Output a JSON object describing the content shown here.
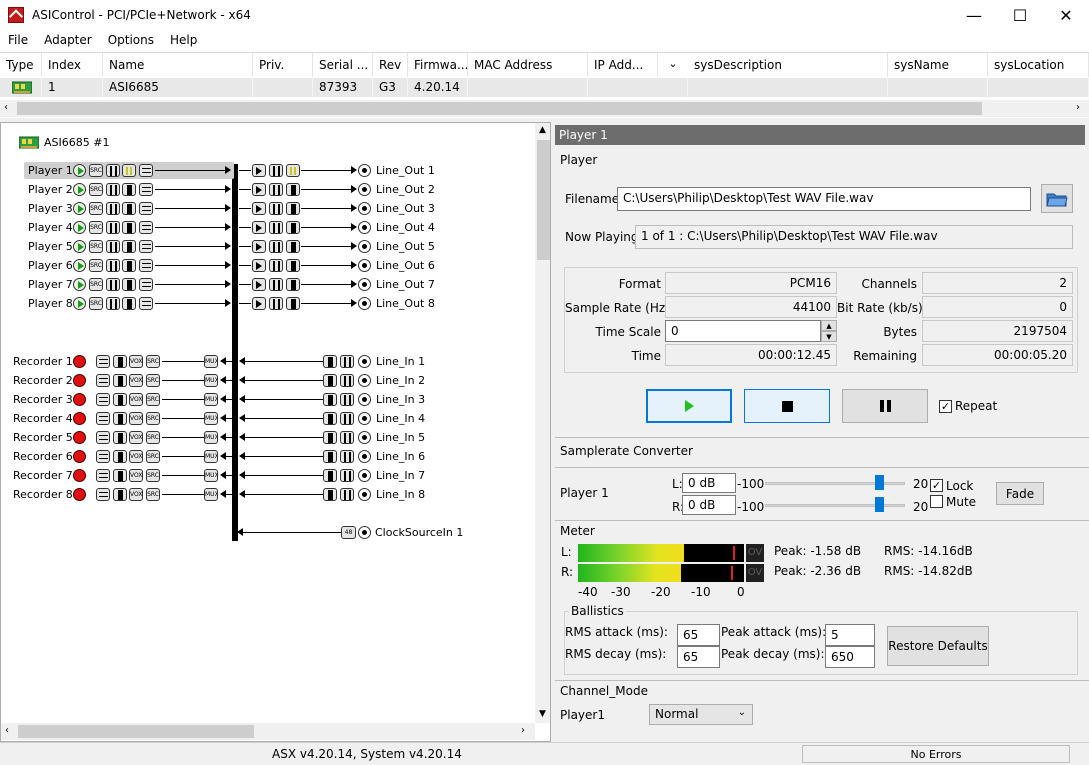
{
  "window": {
    "title": "ASIControl - PCI/PCIe+Network - x64",
    "minimize": "—",
    "maximize": "☐",
    "close": "✕"
  },
  "menu": [
    "File",
    "Adapter",
    "Options",
    "Help"
  ],
  "adapter_table": {
    "columns": [
      "Type",
      "Index",
      "Name",
      "Priv.",
      "Serial ...",
      "Rev",
      "Firmwa...",
      "MAC Address",
      "IP Add...",
      "sysDescription",
      "sysName",
      "sysLocation"
    ],
    "row": {
      "index": "1",
      "name": "ASI6685",
      "priv": "",
      "serial": "87393",
      "rev": "G3",
      "firmware": "4.20.14",
      "mac": "",
      "ip": "",
      "sysdesc": "",
      "sysname": "",
      "syslocation": ""
    }
  },
  "tree": {
    "adapter_label": "ASI6685 #1",
    "players": [
      "Player  1",
      "Player  2",
      "Player  3",
      "Player  4",
      "Player  5",
      "Player  6",
      "Player  7",
      "Player  8"
    ],
    "line_outs": [
      "Line_Out  1",
      "Line_Out  2",
      "Line_Out  3",
      "Line_Out  4",
      "Line_Out  5",
      "Line_Out  6",
      "Line_Out  7",
      "Line_Out  8"
    ],
    "recorders": [
      "Recorder  1",
      "Recorder  2",
      "Recorder  3",
      "Recorder  4",
      "Recorder  5",
      "Recorder  6",
      "Recorder  7",
      "Recorder  8"
    ],
    "line_ins": [
      "Line_In  1",
      "Line_In  2",
      "Line_In  3",
      "Line_In  4",
      "Line_In  5",
      "Line_In  6",
      "Line_In  7",
      "Line_In  8"
    ],
    "clock": "ClockSourceIn  1",
    "chip_src": "SRC",
    "chip_mux": "MUX",
    "chip_vox": "VOX",
    "chip_clock": "48"
  },
  "player_panel": {
    "header": "Player  1",
    "group_title": "Player",
    "filename_label": "Filename",
    "filename_value": "C:\\Users\\Philip\\Desktop\\Test WAV File.wav",
    "now_playing_label": "Now Playing",
    "now_playing_value": "1 of 1 : C:\\Users\\Philip\\Desktop\\Test WAV File.wav",
    "format_label": "Format",
    "format_value": "PCM16",
    "channels_label": "Channels",
    "channels_value": "2",
    "samplerate_label": "Sample Rate (Hz)",
    "samplerate_value": "44100",
    "bitrate_label": "Bit Rate (kb/s)",
    "bitrate_value": "0",
    "timescale_label": "Time Scale",
    "timescale_value": "0",
    "bytes_label": "Bytes",
    "bytes_value": "2197504",
    "time_label": "Time",
    "time_value": "00:00:12.45",
    "remaining_label": "Remaining",
    "remaining_value": "00:00:05.20",
    "repeat_label": "Repeat"
  },
  "src_panel": {
    "title": "Samplerate Converter",
    "player_label": "Player  1",
    "l_label": "L:",
    "r_label": "R:",
    "l_value": "0 dB",
    "r_value": "0 dB",
    "min_label": "-100",
    "max_label": "20",
    "lock_label": "Lock",
    "mute_label": "Mute",
    "fade_label": "Fade"
  },
  "meter": {
    "title": "Meter",
    "l_label": "L:",
    "r_label": "R:",
    "ov_label": "OV",
    "l_peak": "Peak: -1.58 dB",
    "l_rms": "RMS: -14.16dB",
    "r_peak": "Peak: -2.36 dB",
    "r_rms": "RMS: -14.82dB",
    "scale": [
      "-40",
      "-30",
      "-20",
      "-10",
      "0"
    ]
  },
  "ballistics": {
    "title": "Ballistics",
    "rms_attack_label": "RMS attack (ms):",
    "rms_attack_value": "65",
    "rms_decay_label": "RMS decay (ms):",
    "rms_decay_value": "65",
    "peak_attack_label": "Peak attack (ms):",
    "peak_attack_value": "5",
    "peak_decay_label": "Peak decay (ms):",
    "peak_decay_value": "650",
    "restore_label": "Restore Defaults"
  },
  "channel_mode": {
    "title": "Channel_Mode",
    "player_label": "Player1",
    "mode_value": "Normal"
  },
  "status": {
    "version": "ASX v4.20.14, System v4.20.14",
    "errors": "No Errors"
  },
  "colors": {
    "accent": "#0078d7",
    "record": "#e01010",
    "play": "#1a9a1a",
    "header": "#6d6d6d"
  }
}
